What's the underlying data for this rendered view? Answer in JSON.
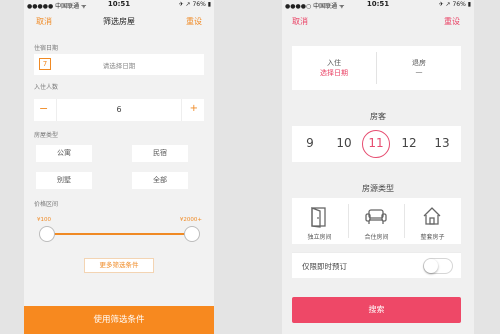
{
  "left_screen": {
    "status": {
      "carrier": "●●●●● 中国联通 ᯤ",
      "time": "10:51",
      "battery": "✈ ↗ 76% ▮"
    },
    "nav": {
      "cancel": "取消",
      "title": "筛选房屋",
      "reset": "重设"
    },
    "checkin": {
      "label": "住宿日期",
      "placeholder": "请选择日期",
      "calendar_number": "7"
    },
    "guests": {
      "label": "入住人数",
      "minus": "−",
      "value": "6",
      "plus": "+"
    },
    "room_type": {
      "label": "房屋类型",
      "options": [
        "公寓",
        "民宿",
        "别墅",
        "全部"
      ]
    },
    "price": {
      "label": "价格区间",
      "min": "¥100",
      "max": "¥2000+"
    },
    "more_filters": "更多筛选条件",
    "apply_button": "使用筛选条件"
  },
  "right_screen": {
    "status": {
      "carrier": "●●●●○ 中国联通 ᯤ",
      "time": "10:51",
      "battery": "✈ ↗ 76% ▮"
    },
    "nav": {
      "cancel": "取消",
      "reset": "重设"
    },
    "checkin": {
      "label": "入住",
      "value": "选择日期"
    },
    "checkout": {
      "label": "退房",
      "value": "—"
    },
    "guests": {
      "label": "房客",
      "numbers": [
        "9",
        "10",
        "11",
        "12",
        "13"
      ],
      "selected": "11"
    },
    "listing_type": {
      "label": "房源类型",
      "options": [
        {
          "label": "独立房间",
          "icon": "door-icon"
        },
        {
          "label": "合住房间",
          "icon": "sofa-icon"
        },
        {
          "label": "整套房子",
          "icon": "house-icon"
        }
      ]
    },
    "instant_book": {
      "label": "仅限即时预订",
      "enabled": false
    },
    "search_button": "搜索"
  },
  "colors": {
    "orange": "#f7891f",
    "pink": "#ee4867"
  }
}
